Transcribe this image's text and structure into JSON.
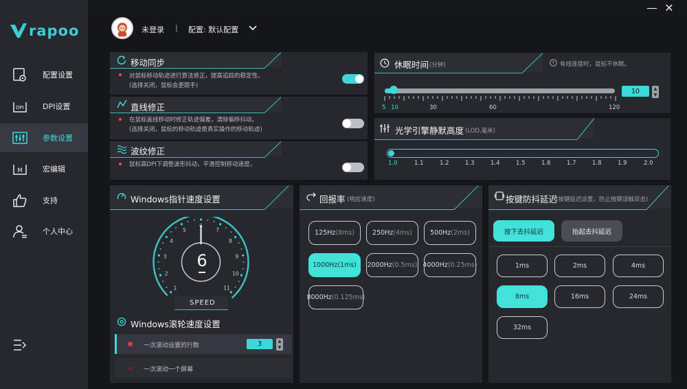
{
  "brand": {
    "logo_text": "rapoo",
    "accent": "#3ecdd6"
  },
  "window": {
    "minimize": "—",
    "close": "✕"
  },
  "header": {
    "user": "未登录",
    "separator": "|",
    "profile_label": "配置: 默认配置"
  },
  "sidebar": {
    "items": [
      {
        "label": "配置设置",
        "icon": "profile-settings-icon"
      },
      {
        "label": "DPI设置",
        "icon": "dpi-icon"
      },
      {
        "label": "参数设置",
        "icon": "parameters-icon",
        "active": true
      },
      {
        "label": "宏编辑",
        "icon": "macro-icon"
      },
      {
        "label": "支持",
        "icon": "thumbs-up-icon"
      },
      {
        "label": "个人中心",
        "icon": "user-center-icon"
      }
    ],
    "collapse_icon": "menu-collapse-icon"
  },
  "motion_sync": {
    "title": "移动同步",
    "desc1": "对鼠标移动轨迹进行算法修正，提高追踪的稳定性。",
    "desc2": "(选择关闭，鼠标会更跟手)",
    "enabled": true
  },
  "angle_snap": {
    "title": "直线修正",
    "desc1": "在鼠标直线移动时修正轨迹偏差，清除偏移抖动。",
    "desc2": "(选择关闭，鼠标的移动轨迹是真实操作的移动轨迹)",
    "enabled": false
  },
  "ripple": {
    "title": "波纹修正",
    "desc1": "鼠标高DPI下调整波形抖动，平滑控制移动速度。",
    "enabled": false
  },
  "sleep": {
    "title": "休眠时间",
    "unit": "(分钟)",
    "note": "有线连接时，鼠标不休眠。",
    "value": "10",
    "labels": [
      "5",
      "10",
      "30",
      "60",
      "120"
    ]
  },
  "lod": {
    "title": "光学引擎静默高度",
    "unit": "(LOD,毫米)",
    "labels": [
      "1.0",
      "1.1",
      "1.2",
      "1.3",
      "1.4",
      "1.5",
      "1.6",
      "1.7",
      "1.8",
      "1.9",
      "2.0"
    ],
    "value": 1.0
  },
  "pointer": {
    "title": "Windows指针速度设置",
    "value": "6",
    "speed_label": "SPEED",
    "dial_numbers": [
      "1",
      "2",
      "3",
      "4",
      "5",
      "6",
      "7",
      "8",
      "9",
      "10",
      "11"
    ]
  },
  "scroll": {
    "title": "Windows滚轮速度设置",
    "row1": "一次滚动设置的行数",
    "row1_value": "3",
    "row2": "一次滚动一个屏幕"
  },
  "polling": {
    "title": "回报率",
    "unit": "(响应速度)",
    "options": [
      {
        "hz": "125Hz",
        "ms": "(8ms)"
      },
      {
        "hz": "250Hz",
        "ms": "(4ms)"
      },
      {
        "hz": "500Hz",
        "ms": "(2ms)"
      },
      {
        "hz": "1000Hz",
        "ms": "(1ms)",
        "selected": true
      },
      {
        "hz": "2000Hz",
        "ms": "(0.5ms)"
      },
      {
        "hz": "4000Hz",
        "ms": "(0.25ms)"
      },
      {
        "hz": "8000Hz",
        "ms": "(0.125ms)"
      }
    ]
  },
  "debounce": {
    "title": "按键防抖延迟",
    "unit": "(按键延迟设置，防止按键误触双击)",
    "tab_press": "按下去抖延迟",
    "tab_release": "抬起去抖延迟",
    "options": [
      "1ms",
      "2ms",
      "4ms",
      "8ms",
      "16ms",
      "24ms",
      "32ms"
    ],
    "selected": "8ms"
  }
}
